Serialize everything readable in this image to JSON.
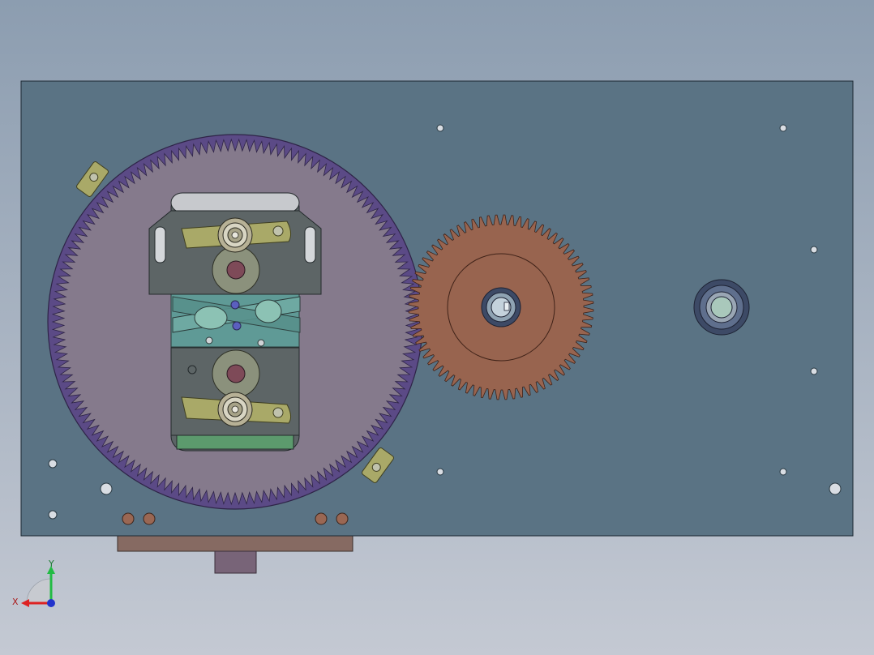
{
  "background": {
    "top_color": "#8c9db0",
    "bottom_color": "#c4c9d3"
  },
  "colors": {
    "base_plate": "#5a7384",
    "ring_gear": "#5b4a86",
    "ring_gear_face": "#857a8c",
    "carrier": "#5c6466",
    "carrier_top": "#c7c9cd",
    "crank_link": "#5f9a96",
    "crank_slot": "#7fb7a6",
    "lever": "#a9a968",
    "bushing": "#8a8f7a",
    "pinion_bore": "#80485a",
    "bearing": "#b0ab92",
    "drive_gear": "#98644f",
    "bottom_rail": "#866a62",
    "bottom_tab": "#786478",
    "copper_pins": "#9a6753",
    "axis_y": "#22bb44",
    "axis_x": "#dd2222",
    "axis_z": "#2233cc"
  },
  "axes_indicator": {
    "x_label": "X",
    "y_label": "Y",
    "icons": [
      "triad-x-arrow-icon",
      "triad-y-arrow-icon",
      "triad-z-dot-icon"
    ]
  }
}
